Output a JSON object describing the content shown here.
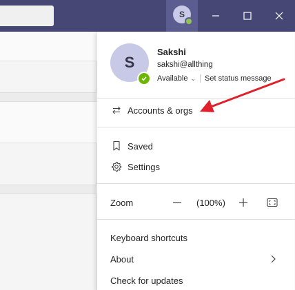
{
  "titlebar": {
    "avatar_initial": "S",
    "minimize_icon": "minimize-icon",
    "maximize_icon": "maximize-icon",
    "close_icon": "close-icon"
  },
  "profile": {
    "initial": "S",
    "name": "Sakshi",
    "email": "sakshi@allthing",
    "status": "Available",
    "set_status": "Set status message",
    "presence_color": "#6bb700"
  },
  "menu": {
    "accounts": "Accounts & orgs",
    "saved": "Saved",
    "settings": "Settings",
    "zoom_label": "Zoom",
    "zoom_minus": "−",
    "zoom_value": "(100%)",
    "zoom_plus": "+",
    "keyboard_shortcuts": "Keyboard shortcuts",
    "about": "About",
    "check_updates": "Check for updates"
  },
  "colors": {
    "titlebar": "#464775",
    "annotation_arrow": "#e0202a"
  }
}
